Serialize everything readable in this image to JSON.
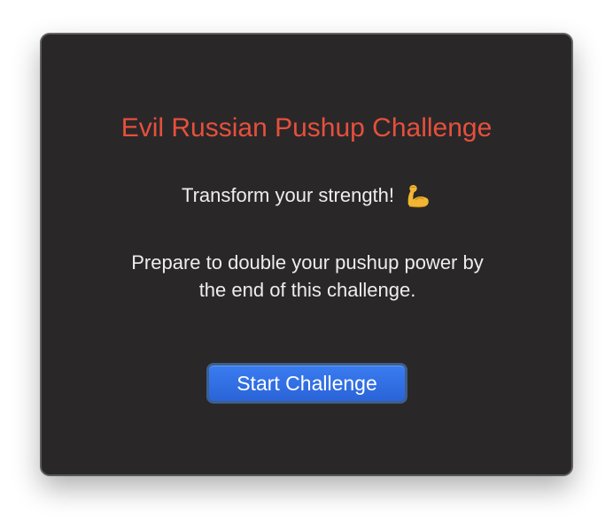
{
  "window": {
    "title": "Evil Russian Pushup Challenge",
    "subtitle": "Transform your strength!",
    "subtitle_icon": "flexed-biceps-icon",
    "description": "Prepare to double your pushup power by the end of this challenge.",
    "start_button_label": "Start Challenge"
  },
  "colors": {
    "background": "#2a2729",
    "title": "#e6503c",
    "text": "#ededed",
    "button": "#2a64d8"
  }
}
